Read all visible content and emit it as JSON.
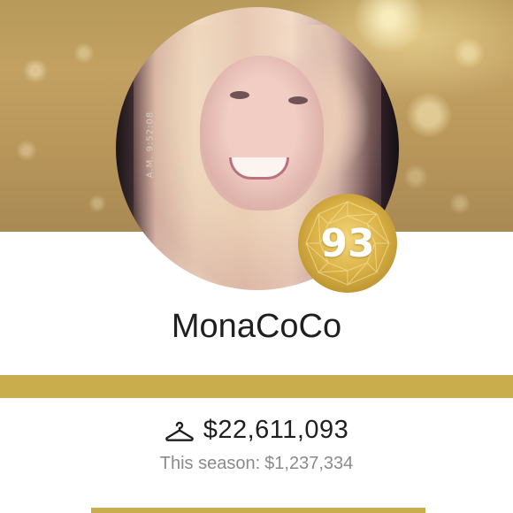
{
  "profile": {
    "username": "MonaCoCo",
    "level": "93",
    "photo_timestamp": "A.M. 9:52:08",
    "avatar_alt": "profile photo"
  },
  "stats": {
    "total_sales": "$22,611,093",
    "season_label": "This season:",
    "season_value": "$1,237,334"
  },
  "icons": {
    "sales": "hanger-icon",
    "badge": "gem-badge-icon"
  },
  "colors": {
    "accent_gold": "#c9ad4c",
    "text_primary": "#1f1f1f",
    "text_secondary": "#8a8a8a"
  }
}
